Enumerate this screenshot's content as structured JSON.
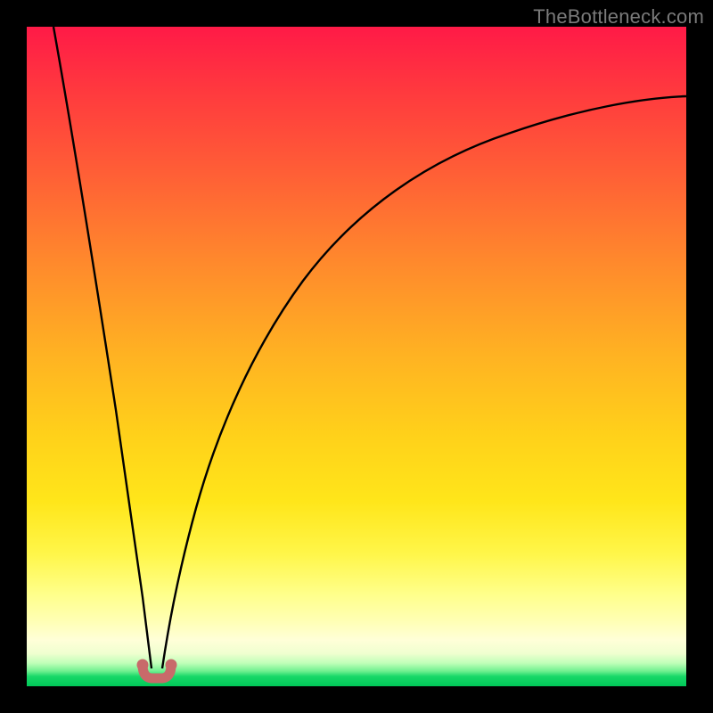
{
  "watermark": {
    "text": "TheBottleneck.com"
  },
  "colors": {
    "frame": "#000000",
    "curve": "#000000",
    "marker": "#c86a6a",
    "gradient_stops": [
      {
        "pos": 0.0,
        "hex": "#ff1a47"
      },
      {
        "pos": 0.1,
        "hex": "#ff3a3e"
      },
      {
        "pos": 0.22,
        "hex": "#ff5e36"
      },
      {
        "pos": 0.36,
        "hex": "#ff8a2c"
      },
      {
        "pos": 0.5,
        "hex": "#ffb322"
      },
      {
        "pos": 0.62,
        "hex": "#ffd11a"
      },
      {
        "pos": 0.72,
        "hex": "#ffe61a"
      },
      {
        "pos": 0.8,
        "hex": "#fff64a"
      },
      {
        "pos": 0.86,
        "hex": "#ffff8a"
      },
      {
        "pos": 0.9,
        "hex": "#ffffb3"
      },
      {
        "pos": 0.93,
        "hex": "#ffffd8"
      },
      {
        "pos": 0.95,
        "hex": "#f0ffd0"
      },
      {
        "pos": 0.965,
        "hex": "#c0ffb8"
      },
      {
        "pos": 0.977,
        "hex": "#70f090"
      },
      {
        "pos": 0.985,
        "hex": "#18d868"
      },
      {
        "pos": 1.0,
        "hex": "#00c858"
      }
    ]
  },
  "chart_data": {
    "type": "line",
    "title": "",
    "xlabel": "",
    "ylabel": "",
    "notes": "Bottleneck-style V curve. X is normalized 0..1 across plot width; Y is normalized 0..1 (0 = bottom/optimal, 1 = top/worst). Valley near x≈0.19 at y≈0. Left branch rises steeply to y=1 at x=0; right branch rises with diminishing slope to y≈0.86 at x=1.",
    "xlim": [
      0,
      1
    ],
    "ylim": [
      0,
      1
    ],
    "x": [
      0.0,
      0.03,
      0.06,
      0.09,
      0.12,
      0.145,
      0.165,
      0.18,
      0.19,
      0.2,
      0.215,
      0.24,
      0.28,
      0.33,
      0.4,
      0.48,
      0.57,
      0.67,
      0.78,
      0.89,
      1.0
    ],
    "values": [
      1.0,
      0.84,
      0.68,
      0.52,
      0.36,
      0.22,
      0.11,
      0.03,
      0.0,
      0.03,
      0.09,
      0.19,
      0.31,
      0.42,
      0.53,
      0.62,
      0.69,
      0.75,
      0.8,
      0.83,
      0.86
    ],
    "markers": {
      "x": [
        0.175,
        0.19,
        0.205
      ],
      "y": [
        0.012,
        0.004,
        0.012
      ],
      "shape": "rounded-U"
    }
  }
}
